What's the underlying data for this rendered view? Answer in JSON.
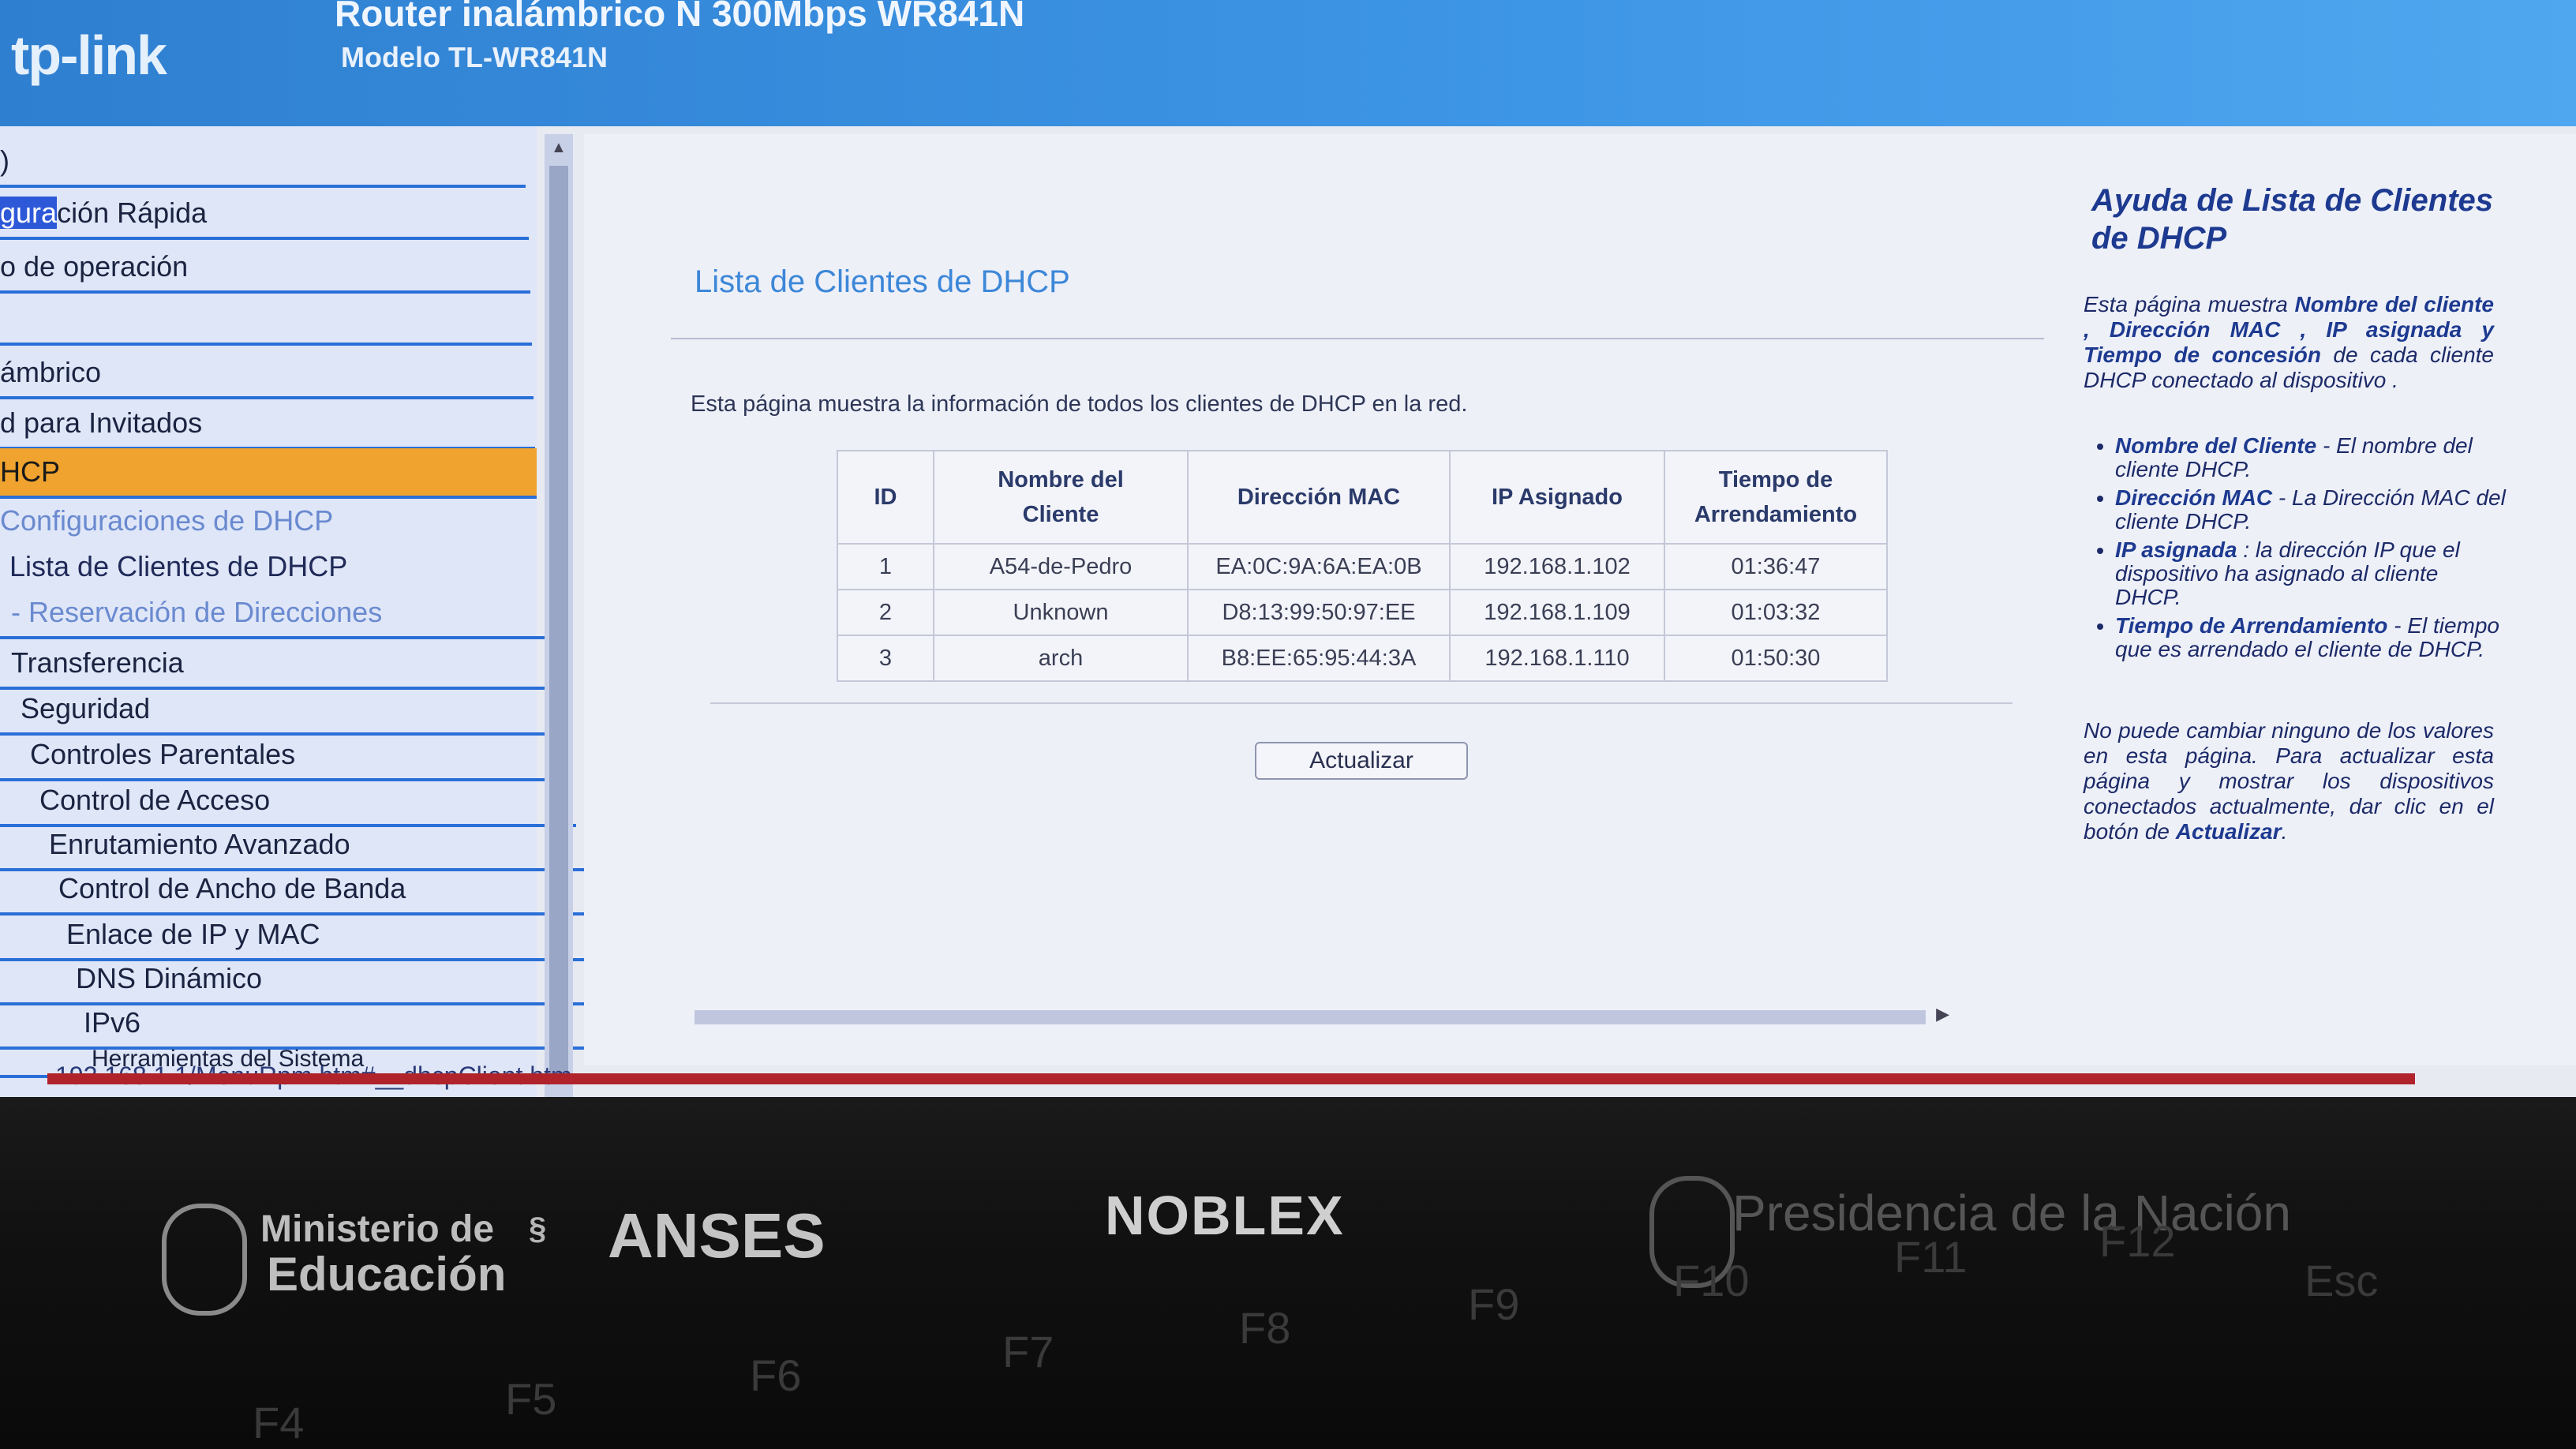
{
  "header": {
    "logo": "tp-link",
    "title": "Router inalámbrico N 300Mbps WR841N",
    "model": "Modelo TL-WR841N"
  },
  "sidebar": {
    "items": [
      {
        "label": ")"
      },
      {
        "label_hl": "gura",
        "label": "ción Rápida"
      },
      {
        "label": "o de operación"
      },
      {
        "label": ""
      },
      {
        "label": "ámbrico"
      },
      {
        "label": "d para Invitados"
      },
      {
        "label": "HCP"
      },
      {
        "label": "Configuraciones de DHCP"
      },
      {
        "label": "Lista de Clientes de DHCP"
      },
      {
        "label": "- Reservación de Direcciones"
      },
      {
        "label": "Transferencia"
      },
      {
        "label": "Seguridad"
      },
      {
        "label": "Controles Parentales"
      },
      {
        "label": "Control de Acceso"
      },
      {
        "label": "Enrutamiento Avanzado"
      },
      {
        "label": "Control de Ancho de Banda"
      },
      {
        "label": "Enlace de IP y MAC"
      },
      {
        "label": "DNS Dinámico"
      },
      {
        "label": "IPv6"
      },
      {
        "label": "Herramientas del Sistema"
      }
    ]
  },
  "status_bar": {
    "url": "192.168.1.1/MenuRpm.htm#__dhcpClient.htm"
  },
  "main": {
    "title": "Lista de Clientes de DHCP",
    "intro": "Esta página muestra la información de todos los clientes de DHCP en la red.",
    "table": {
      "headers": [
        "ID",
        "Nombre del Cliente",
        "Dirección MAC",
        "IP Asignado",
        "Tiempo de Arrendamiento"
      ],
      "rows": [
        [
          "1",
          "A54-de-Pedro",
          "EA:0C:9A:6A:EA:0B",
          "192.168.1.102",
          "01:36:47"
        ],
        [
          "2",
          "Unknown",
          "D8:13:99:50:97:EE",
          "192.168.1.109",
          "01:03:32"
        ],
        [
          "3",
          "arch",
          "B8:EE:65:95:44:3A",
          "192.168.1.110",
          "01:50:30"
        ]
      ]
    },
    "refresh_label": "Actualizar"
  },
  "help": {
    "title": "Ayuda de Lista de Clientes de DHCP",
    "intro_pre": "Esta página muestra ",
    "intro_bold": "Nombre del cliente , Dirección MAC , IP asignada y Tiempo de concesión",
    "intro_post": " de cada cliente DHCP conectado al dispositivo .",
    "bullets": [
      {
        "term": "Nombre del Cliente",
        "text": " - El nombre del cliente DHCP."
      },
      {
        "term": "Dirección MAC",
        "text": " - La Dirección MAC del cliente DHCP."
      },
      {
        "term": "IP asignada",
        "text": " : la dirección IP que el dispositivo ha asignado al cliente DHCP."
      },
      {
        "term": "Tiempo de Arrendamiento",
        "text": " - El tiempo que es arrendado el cliente de DHCP."
      }
    ],
    "note_pre": "No puede cambiar ninguno de los valores en esta página. Para actualizar esta página y mostrar los dispositivos conectados actualmente, dar clic en el botón de ",
    "note_bold": "Actualizar",
    "note_post": "."
  },
  "laptop": {
    "brand_left_1": "Ministerio de",
    "brand_left_2": "Educación",
    "brand_anses": "ANSES",
    "brand_center": "NOBLEX",
    "brand_right": "Presidencia de la Nación",
    "fkeys": [
      "F4",
      "F5",
      "F6",
      "F7",
      "F8",
      "F9",
      "F10",
      "F11",
      "F12",
      "Esc"
    ]
  },
  "colors": {
    "header_blue": "#3e96e6",
    "active_orange": "#f0a32e",
    "title_blue": "#3c87d8"
  }
}
